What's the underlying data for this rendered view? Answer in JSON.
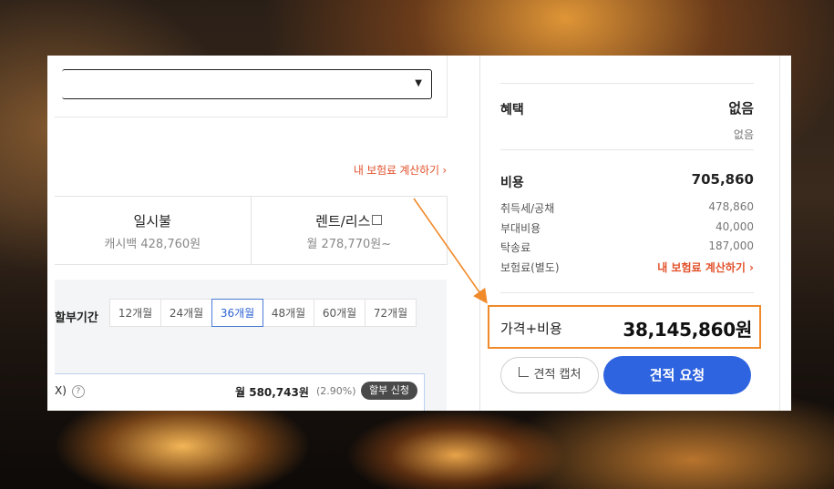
{
  "left": {
    "calc_link": "내 보험료 계산하기 ›",
    "payment_options": [
      {
        "title": "일시불",
        "sub": "캐시백 428,760원"
      },
      {
        "title": "렌트/리스",
        "sub": "월 278,770원~"
      }
    ],
    "term": {
      "label": "할부기간",
      "tabs": [
        "12개월",
        "24개월",
        "36개월",
        "48개월",
        "60개월",
        "72개월"
      ],
      "active": "36개월"
    },
    "installment": {
      "label": "X)",
      "help": "?",
      "monthly": "월 580,743원",
      "rate": "(2.90%)",
      "apply": "할부 신청"
    }
  },
  "right": {
    "benefit": {
      "label": "혜택",
      "value": "없음",
      "sub": "없음"
    },
    "cost": {
      "label": "비용",
      "value": "705,860"
    },
    "items": [
      {
        "label": "취득세/공채",
        "value": "478,860"
      },
      {
        "label": "부대비용",
        "value": "40,000"
      },
      {
        "label": "탁송료",
        "value": "187,000"
      },
      {
        "label": "보험료(별도)",
        "value": "내 보험료 계산하기 ›"
      }
    ],
    "total": {
      "label": "가격+비용",
      "value": "38,145,860원"
    },
    "capture_button": "견적 캡처",
    "request_button": "견적 요청"
  },
  "colors": {
    "accent_orange": "#f08a2a",
    "link_red": "#e2512b",
    "primary_blue": "#2f64e0"
  }
}
